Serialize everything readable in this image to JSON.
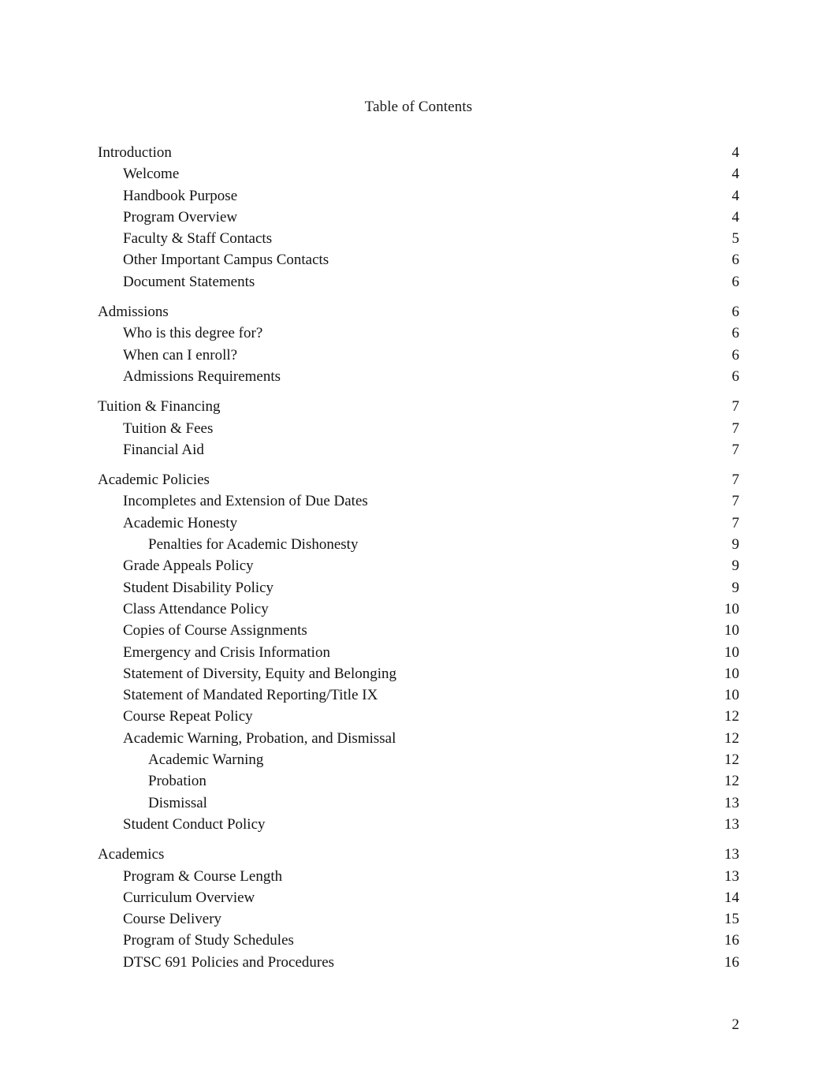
{
  "document": {
    "title": "Table of Contents",
    "footer_page_number": "2"
  },
  "toc": {
    "entries": [
      {
        "label": "Introduction",
        "page": "4",
        "level": 1,
        "group_start": false
      },
      {
        "label": "Welcome",
        "page": "4",
        "level": 2,
        "group_start": false
      },
      {
        "label": "Handbook Purpose",
        "page": "4",
        "level": 2,
        "group_start": false
      },
      {
        "label": "Program Overview",
        "page": "4",
        "level": 2,
        "group_start": false
      },
      {
        "label": "Faculty & Staff Contacts",
        "page": "5",
        "level": 2,
        "group_start": false
      },
      {
        "label": "Other Important Campus Contacts",
        "page": "6",
        "level": 2,
        "group_start": false
      },
      {
        "label": "Document Statements",
        "page": "6",
        "level": 2,
        "group_start": false
      },
      {
        "label": "Admissions",
        "page": "6",
        "level": 1,
        "group_start": true
      },
      {
        "label": "Who is this degree for?",
        "page": "6",
        "level": 2,
        "group_start": false
      },
      {
        "label": "When can I enroll?",
        "page": "6",
        "level": 2,
        "group_start": false
      },
      {
        "label": "Admissions Requirements",
        "page": "6",
        "level": 2,
        "group_start": false
      },
      {
        "label": "Tuition & Financing",
        "page": "7",
        "level": 1,
        "group_start": true
      },
      {
        "label": "Tuition & Fees",
        "page": "7",
        "level": 2,
        "group_start": false
      },
      {
        "label": "Financial Aid",
        "page": "7",
        "level": 2,
        "group_start": false
      },
      {
        "label": "Academic Policies",
        "page": "7",
        "level": 1,
        "group_start": true
      },
      {
        "label": "Incompletes and Extension of Due Dates",
        "page": "7",
        "level": 2,
        "group_start": false
      },
      {
        "label": "Academic Honesty",
        "page": "7",
        "level": 2,
        "group_start": false
      },
      {
        "label": "Penalties for Academic Dishonesty",
        "page": "9",
        "level": 3,
        "group_start": false
      },
      {
        "label": "Grade Appeals Policy",
        "page": "9",
        "level": 2,
        "group_start": false
      },
      {
        "label": "Student Disability Policy",
        "page": "9",
        "level": 2,
        "group_start": false
      },
      {
        "label": "Class Attendance Policy",
        "page": "10",
        "level": 2,
        "group_start": false
      },
      {
        "label": "Copies of Course Assignments",
        "page": "10",
        "level": 2,
        "group_start": false
      },
      {
        "label": "Emergency and Crisis Information",
        "page": "10",
        "level": 2,
        "group_start": false
      },
      {
        "label": "Statement of Diversity, Equity and Belonging",
        "page": "10",
        "level": 2,
        "group_start": false
      },
      {
        "label": "Statement of Mandated Reporting/Title IX",
        "page": "10",
        "level": 2,
        "group_start": false
      },
      {
        "label": "Course Repeat Policy",
        "page": "12",
        "level": 2,
        "group_start": false
      },
      {
        "label": "Academic Warning, Probation, and Dismissal",
        "page": "12",
        "level": 2,
        "group_start": false
      },
      {
        "label": "Academic Warning",
        "page": "12",
        "level": 3,
        "group_start": false
      },
      {
        "label": "Probation",
        "page": "12",
        "level": 3,
        "group_start": false
      },
      {
        "label": "Dismissal",
        "page": "13",
        "level": 3,
        "group_start": false
      },
      {
        "label": "Student Conduct Policy",
        "page": "13",
        "level": 2,
        "group_start": false
      },
      {
        "label": "Academics",
        "page": "13",
        "level": 1,
        "group_start": true
      },
      {
        "label": "Program & Course Length",
        "page": "13",
        "level": 2,
        "group_start": false
      },
      {
        "label": "Curriculum Overview",
        "page": "14",
        "level": 2,
        "group_start": false
      },
      {
        "label": "Course Delivery",
        "page": "15",
        "level": 2,
        "group_start": false
      },
      {
        "label": "Program of Study Schedules",
        "page": "16",
        "level": 2,
        "group_start": false
      },
      {
        "label": "DTSC 691 Policies and Procedures",
        "page": "16",
        "level": 2,
        "group_start": false
      }
    ]
  }
}
